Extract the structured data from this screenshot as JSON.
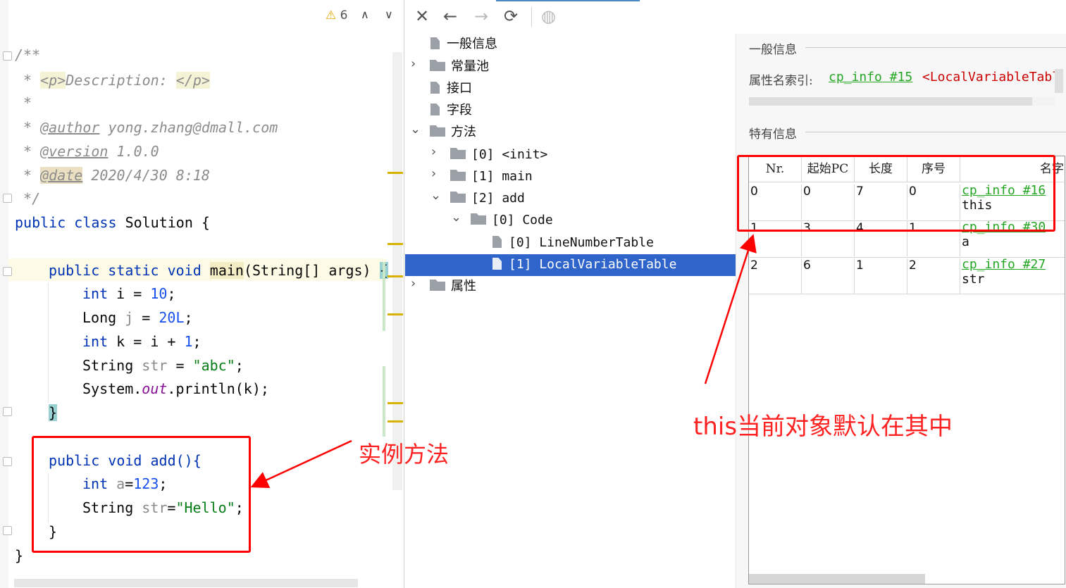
{
  "editor": {
    "warning_count": "6",
    "code_lines": {
      "l1": "/**",
      "l2_star": " * ",
      "l2_tag_open": "<p>",
      "l2_text": "Description: ",
      "l2_tag_close": "</p>",
      "l3": " *",
      "l4_star": " * ",
      "l4_tag": "@author",
      "l4_text": " yong.zhang@dmall.com",
      "l5_star": " * ",
      "l5_tag": "@version",
      "l5_text": " 1.0.0",
      "l6_star": " * ",
      "l6_tag": "@date",
      "l6_text": " 2020/4/30 8:18",
      "l7": " */",
      "l8_kw1": "public",
      "l8_kw2": "class",
      "l8_name": "Solution {",
      "l9_kw": "public static void",
      "l9_name": "main",
      "l9_rest": "(String[] args) ",
      "l9_brace": "{",
      "l10_kw": "int",
      "l10_var": " i = ",
      "l10_num": "10",
      "l10_end": ";",
      "l11_type": "Long ",
      "l11_var": "j",
      "l11_eq": " = ",
      "l11_num": "20L",
      "l11_end": ";",
      "l12_kw": "int",
      "l12_var": " k = i + ",
      "l12_num": "1",
      "l12_end": ";",
      "l13_type": "String ",
      "l13_var": "str",
      "l13_eq": " = ",
      "l13_str": "\"abc\"",
      "l13_end": ";",
      "l14_a": "System.",
      "l14_fld": "out",
      "l14_b": ".println(k);",
      "l15": "}",
      "l16_kw": "public void",
      "l16_name": " add(){",
      "l17_kw": "int",
      "l17_var": " a",
      "l17_rest": "=",
      "l17_num": "123",
      "l17_end": ";",
      "l18_type": "String ",
      "l18_var": "str",
      "l18_eq": "=",
      "l18_str": "\"Hello\"",
      "l18_end": ";",
      "l19": "}",
      "l20": "}"
    }
  },
  "tree": {
    "general_info": "一般信息",
    "constant_pool": "常量池",
    "interfaces": "接口",
    "fields": "字段",
    "methods": "方法",
    "m0": "[0] <init>",
    "m1": "[1] main",
    "m2": "[2] add",
    "code": "[0] Code",
    "lnt": "[0] LineNumberTable",
    "lvt": "[1] LocalVariableTable",
    "attributes": "属性"
  },
  "info": {
    "general_title": "一般信息",
    "attr_name_label": "属性名索引:",
    "attr_name_link": "cp_info #15",
    "attr_name_value": "<LocalVariableTable>",
    "special_title": "特有信息"
  },
  "table": {
    "headers": [
      "Nr.",
      "起始PC",
      "长度",
      "序号",
      "名字"
    ],
    "rows": [
      {
        "nr": "0",
        "pc": "0",
        "len": "7",
        "idx": "0",
        "link": "cp_info #16",
        "name": "this"
      },
      {
        "nr": "1",
        "pc": "3",
        "len": "4",
        "idx": "1",
        "link": "cp_info #30",
        "name": "a"
      },
      {
        "nr": "2",
        "pc": "6",
        "len": "1",
        "idx": "2",
        "link": "cp_info #27",
        "name": "str"
      }
    ]
  },
  "annotations": {
    "instance_method": "实例方法",
    "this_note": "this当前对象默认在其中"
  },
  "colors": {
    "annotation_red": "#ff0000",
    "selection_blue": "#2f65ca",
    "link_green": "#25a624",
    "keyword_blue": "#0033b3"
  }
}
